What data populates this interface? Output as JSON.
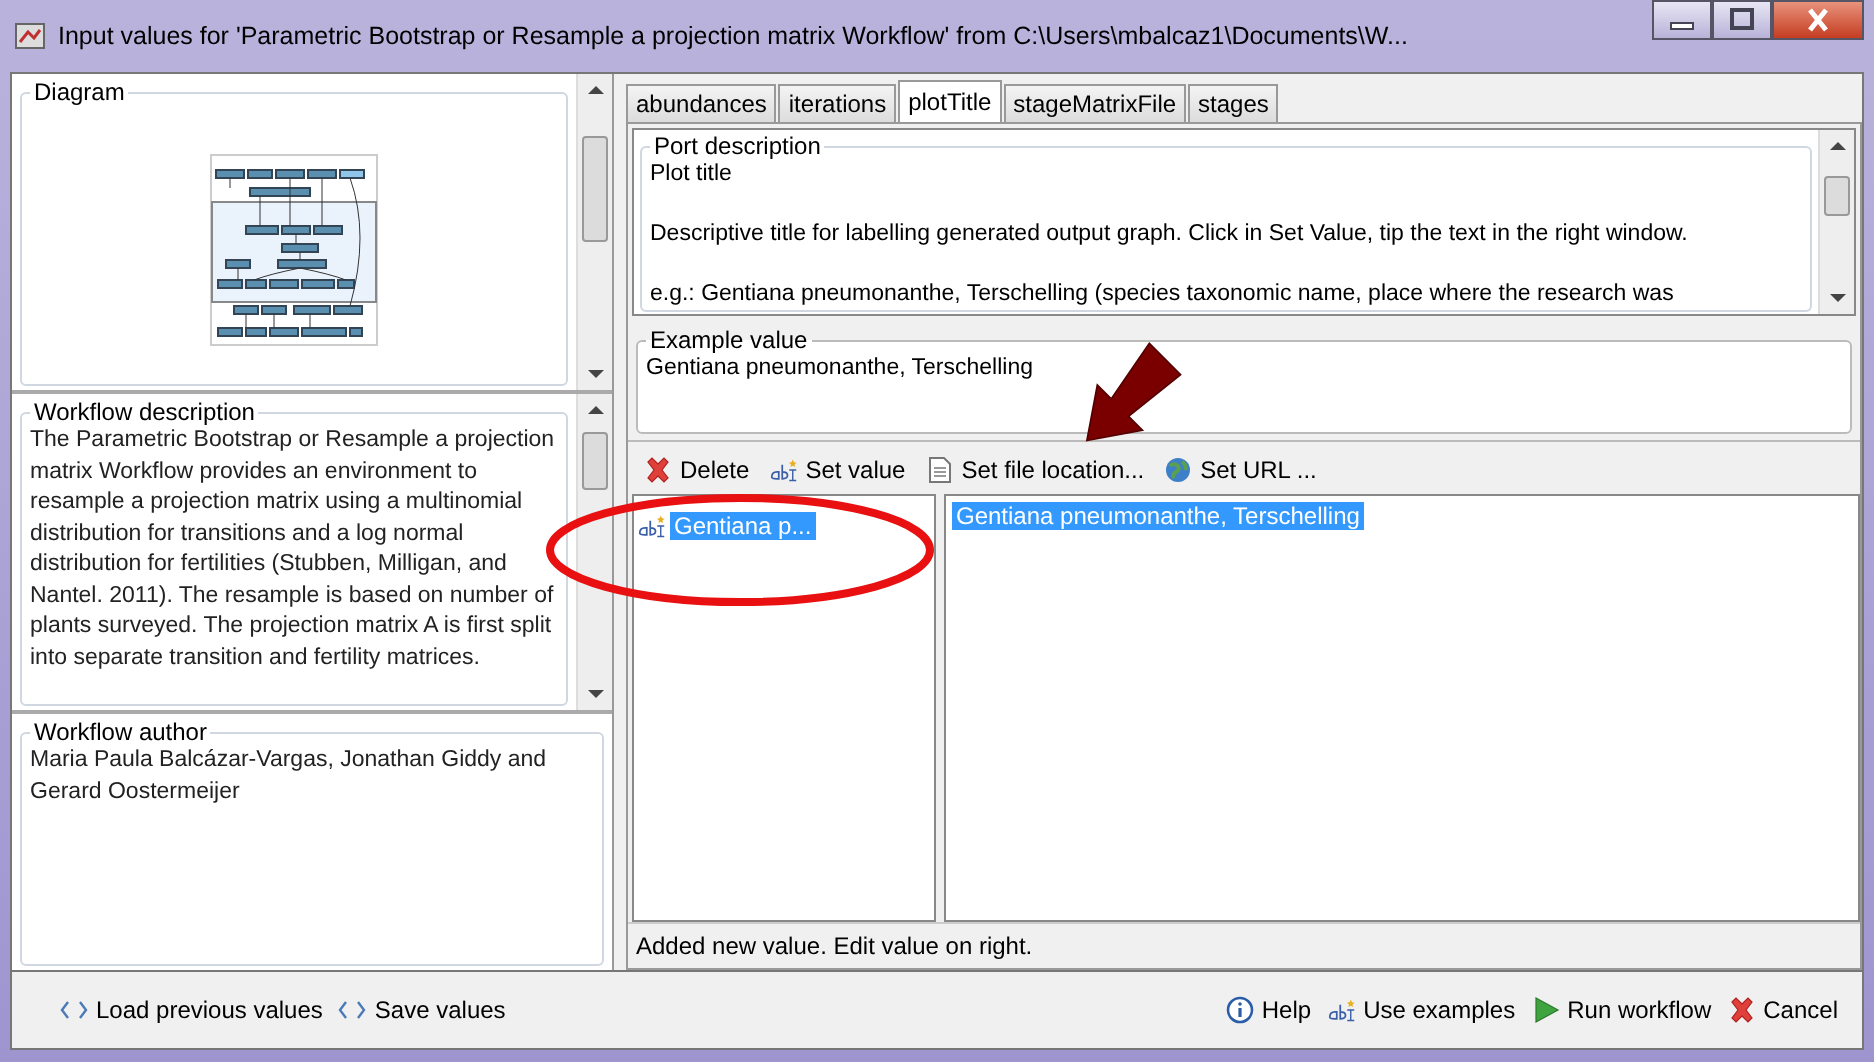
{
  "window": {
    "title": "Input values for 'Parametric Bootstrap or Resample a projection matrix Workflow' from C:\\Users\\mbalcaz1\\Documents\\W..."
  },
  "diagram": {
    "title": "Diagram"
  },
  "description": {
    "title": "Workflow description",
    "text": "The Parametric Bootstrap or Resample a projection matrix Workflow provides an environment to resample a projection matrix using a multinomial distribution for transitions and a log normal distribution for fertilities (Stubben, Milligan, and Nantel. 2011). The resample is based on number of plants surveyed. The projection matrix A is first split into separate transition and fertility matrices."
  },
  "author": {
    "title": "Workflow author",
    "text": "Maria Paula Balcázar-Vargas, Jonathan Giddy and Gerard Oostermeijer"
  },
  "tabs": [
    {
      "label": "abundances",
      "selected": false
    },
    {
      "label": "iterations",
      "selected": false
    },
    {
      "label": "plotTitle",
      "selected": true
    },
    {
      "label": "stageMatrixFile",
      "selected": false
    },
    {
      "label": "stages",
      "selected": false
    }
  ],
  "port_description": {
    "title": "Port description",
    "paragraphs": [
      "Plot title",
      "Descriptive title for labelling generated output graph. Click in Set Value, tip the text in the right window.",
      "e.g.: Gentiana pneumonanthe, Terschelling (species taxonomic name, place where the research was"
    ]
  },
  "example_value": {
    "title": "Example value",
    "text": "Gentiana pneumonanthe, Terschelling"
  },
  "toolbar": [
    {
      "kind": "delete",
      "label": "Delete"
    },
    {
      "kind": "text",
      "label": "Set value"
    },
    {
      "kind": "file",
      "label": "Set file location..."
    },
    {
      "kind": "url",
      "label": "Set URL ..."
    }
  ],
  "values_list": [
    {
      "label": "Gentiana p...",
      "selected": true
    }
  ],
  "value_editor": {
    "text": "Gentiana pneumonanthe, Terschelling",
    "selected": true
  },
  "status": "Added new value.  Edit value on right.",
  "bottom_left": [
    {
      "label": "Load previous values"
    },
    {
      "label": "Save values"
    }
  ],
  "bottom_right": [
    {
      "kind": "help",
      "label": "Help"
    },
    {
      "kind": "text",
      "label": "Use examples"
    },
    {
      "kind": "run",
      "label": "Run workflow"
    },
    {
      "kind": "cancel",
      "label": "Cancel"
    }
  ],
  "annotations": [
    {
      "kind": "arrow"
    },
    {
      "kind": "ellipse"
    }
  ]
}
